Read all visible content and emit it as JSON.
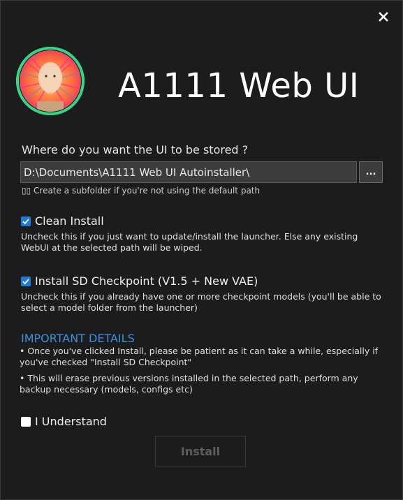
{
  "window": {
    "title": "A1111 Web UI",
    "close_icon": "close-icon"
  },
  "header": {
    "avatar_icon": "avatar-portrait",
    "avatar_ring_color": "#30d98a"
  },
  "storage": {
    "question": "Where do you want the UI to be stored ?",
    "path_value": "D:\\Documents\\A1111 Web UI Autoinstaller\\",
    "browse_label": "...",
    "hint": "▯▯ Create a subfolder if you're not using the default path"
  },
  "options": {
    "clean_install": {
      "label": "Clean Install",
      "checked": true,
      "description": "Uncheck this if you just want to update/install the launcher. Else any existing WebUI at the selected path will be wiped."
    },
    "sd_checkpoint": {
      "label": "Install SD Checkpoint (V1.5 + New VAE)",
      "checked": true,
      "description": "Uncheck this if you already have one or more checkpoint models (you'll be able to select a model folder from the launcher)"
    }
  },
  "details": {
    "title": "IMPORTANT DETAILS",
    "bullet_1": "• Once you've clicked Install, please be patient as it can take a while, especially if you've checked \"Install SD Checkpoint\"",
    "bullet_2": "• This will erase previous versions installed in the selected path, perform any backup necessary (models, configs etc)"
  },
  "understand": {
    "label": "I Understand",
    "checked": false
  },
  "install": {
    "label": "Install",
    "enabled": false
  },
  "colors": {
    "background": "#1c1c1c",
    "accent": "#1e7ad6",
    "section_title": "#3d8fe0",
    "avatar_ring": "#30d98a"
  }
}
